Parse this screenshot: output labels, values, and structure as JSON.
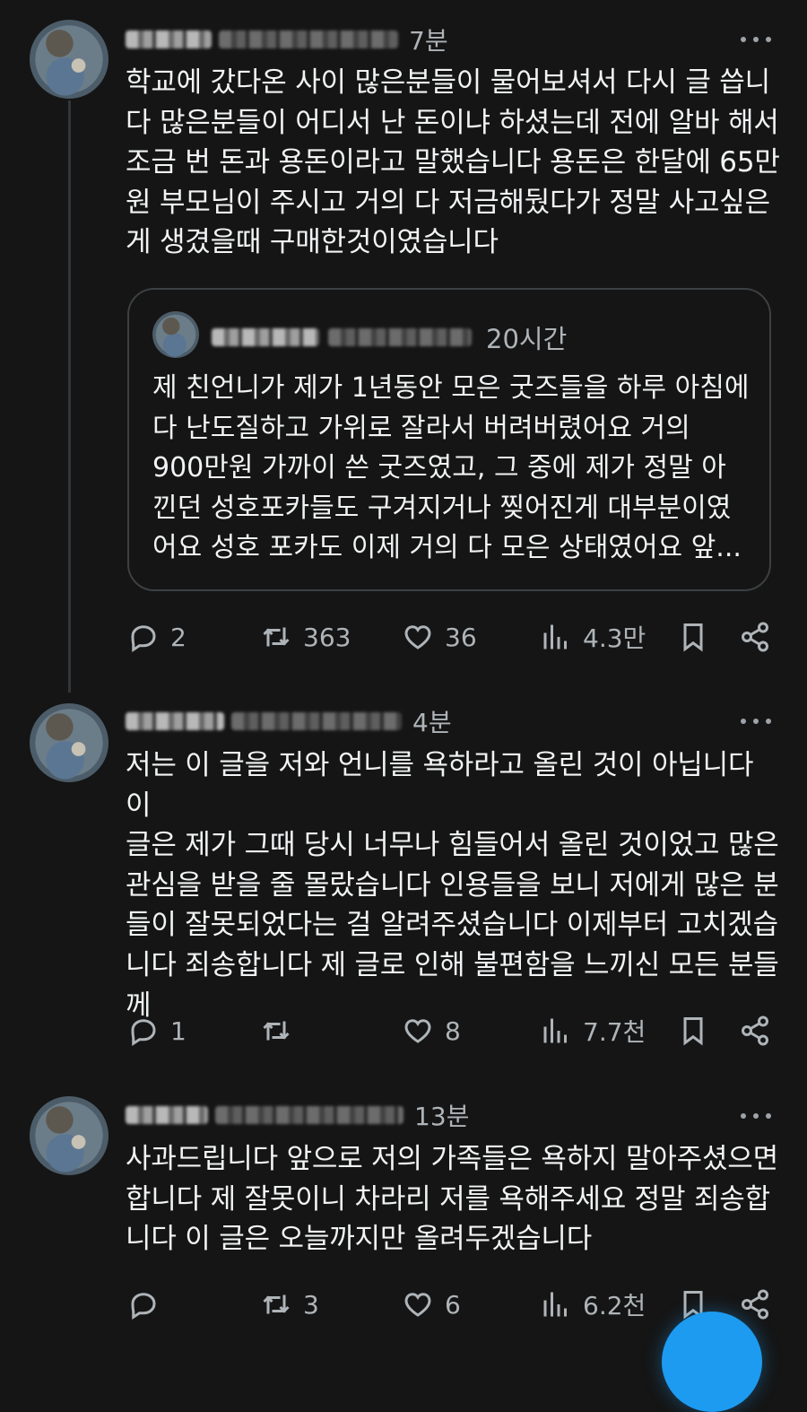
{
  "posts": [
    {
      "time": "7분",
      "text": "학교에 갔다온 사이 많은분들이 물어보셔서 다시 글 씁니\n다 많은분들이 어디서 난 돈이냐 하셨는데 전에 알바 해서\n조금 번 돈과 용돈이라고 말했습니다 용돈은 한달에 65만\n원 부모님이 주시고 거의 다 저금해뒀다가 정말 사고싶은\n게 생겼을때 구매한것이였습니다",
      "quote": {
        "time": "20시간",
        "text": "제 친언니가 제가 1년동안 모은 굿즈들을 하루 아침에\n다 난도질하고 가위로 잘라서 버려버렸어요 거의\n900만원 가까이 쓴 굿즈였고, 그 중에 제가 정말 아\n낀던 성호포카들도 구겨지거나 찢어진게 대부분이였\n어요 성호 포카도 이제 거의 다 모은 상태였어요 앞..."
      },
      "stats": {
        "replies": "2",
        "reposts": "363",
        "likes": "36",
        "views": "4.3만"
      }
    },
    {
      "time": "4분",
      "text": "저는 이 글을 저와 언니를 욕하라고 올린 것이 아닙니다 이\n글은 제가 그때 당시 너무나 힘들어서 올린 것이었고 많은\n관심을 받을 줄 몰랐습니다 인용들을 보니 저에게 많은 분\n들이 잘못되었다는 걸 알려주셨습니다 이제부터 고치겠습\n니다 죄송합니다 제 글로 인해 불편함을 느끼신 모든 분들\n께",
      "stats": {
        "replies": "1",
        "reposts": "",
        "likes": "8",
        "views": "7.7천"
      }
    },
    {
      "time": "13분",
      "text": "사과드립니다 앞으로 저의 가족들은 욕하지 말아주셨으면\n합니다 제 잘못이니 차라리 저를 욕해주세요 정말 죄송합\n니다 이 글은 오늘까지만 올려두겠습니다",
      "stats": {
        "replies": "",
        "reposts": "3",
        "likes": "6",
        "views": "6.2천"
      }
    }
  ],
  "colors": {
    "background": "#151515",
    "text": "#e7e9ea",
    "muted": "#aeb4b8",
    "accent": "#1d9bf0"
  },
  "icons": [
    "more-icon",
    "reply-icon",
    "repost-icon",
    "like-icon",
    "views-icon",
    "bookmark-icon",
    "share-icon"
  ]
}
